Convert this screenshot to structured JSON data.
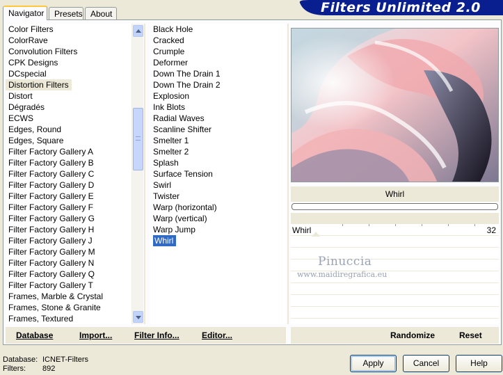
{
  "tabs": [
    {
      "label": "Navigator",
      "active": true
    },
    {
      "label": "Presets"
    },
    {
      "label": "About"
    }
  ],
  "banner": {
    "title": "Filters Unlimited 2.0",
    "color": "#0a1f8f"
  },
  "categories": {
    "selected": "Distortion Filters",
    "items": [
      "Color Filters",
      "ColorRave",
      "Convolution Filters",
      "CPK Designs",
      "DCspecial",
      "Distortion Filters",
      "Distort",
      "Dégradés",
      "ECWS",
      "Edges, Round",
      "Edges, Square",
      "Filter Factory Gallery A",
      "Filter Factory Gallery B",
      "Filter Factory Gallery C",
      "Filter Factory Gallery D",
      "Filter Factory Gallery E",
      "Filter Factory Gallery F",
      "Filter Factory Gallery G",
      "Filter Factory Gallery H",
      "Filter Factory Gallery J",
      "Filter Factory Gallery M",
      "Filter Factory Gallery N",
      "Filter Factory Gallery Q",
      "Filter Factory Gallery T",
      "Frames, Marble & Crystal",
      "Frames, Stone & Granite",
      "Frames, Textured"
    ]
  },
  "filters": {
    "selected": "Whirl",
    "items": [
      "Black Hole",
      "Cracked",
      "Crumple",
      "Deformer",
      "Down The Drain 1",
      "Down The Drain 2",
      "Explosion",
      "Ink Blots",
      "Radial Waves",
      "Scanline Shifter",
      "Smelter 1",
      "Smelter 2",
      "Splash",
      "Surface Tension",
      "Swirl",
      "Twister",
      "Warp (horizontal)",
      "Warp (vertical)",
      "Warp Jump",
      "Whirl"
    ]
  },
  "params": {
    "title": "Whirl",
    "slider_label": "Whirl",
    "slider_value": "32"
  },
  "watermark": {
    "line1": "Pinuccia",
    "line2": "www.maidiregrafica.eu"
  },
  "links": {
    "database": "Database",
    "import": "Import...",
    "filter_info": "Filter Info...",
    "editor": "Editor...",
    "randomize": "Randomize",
    "reset": "Reset"
  },
  "status": {
    "database_label": "Database:",
    "database_value": "ICNET-Filters",
    "filters_label": "Filters:",
    "filters_value": "892"
  },
  "buttons": {
    "apply": "Apply",
    "cancel": "Cancel",
    "help": "Help"
  }
}
